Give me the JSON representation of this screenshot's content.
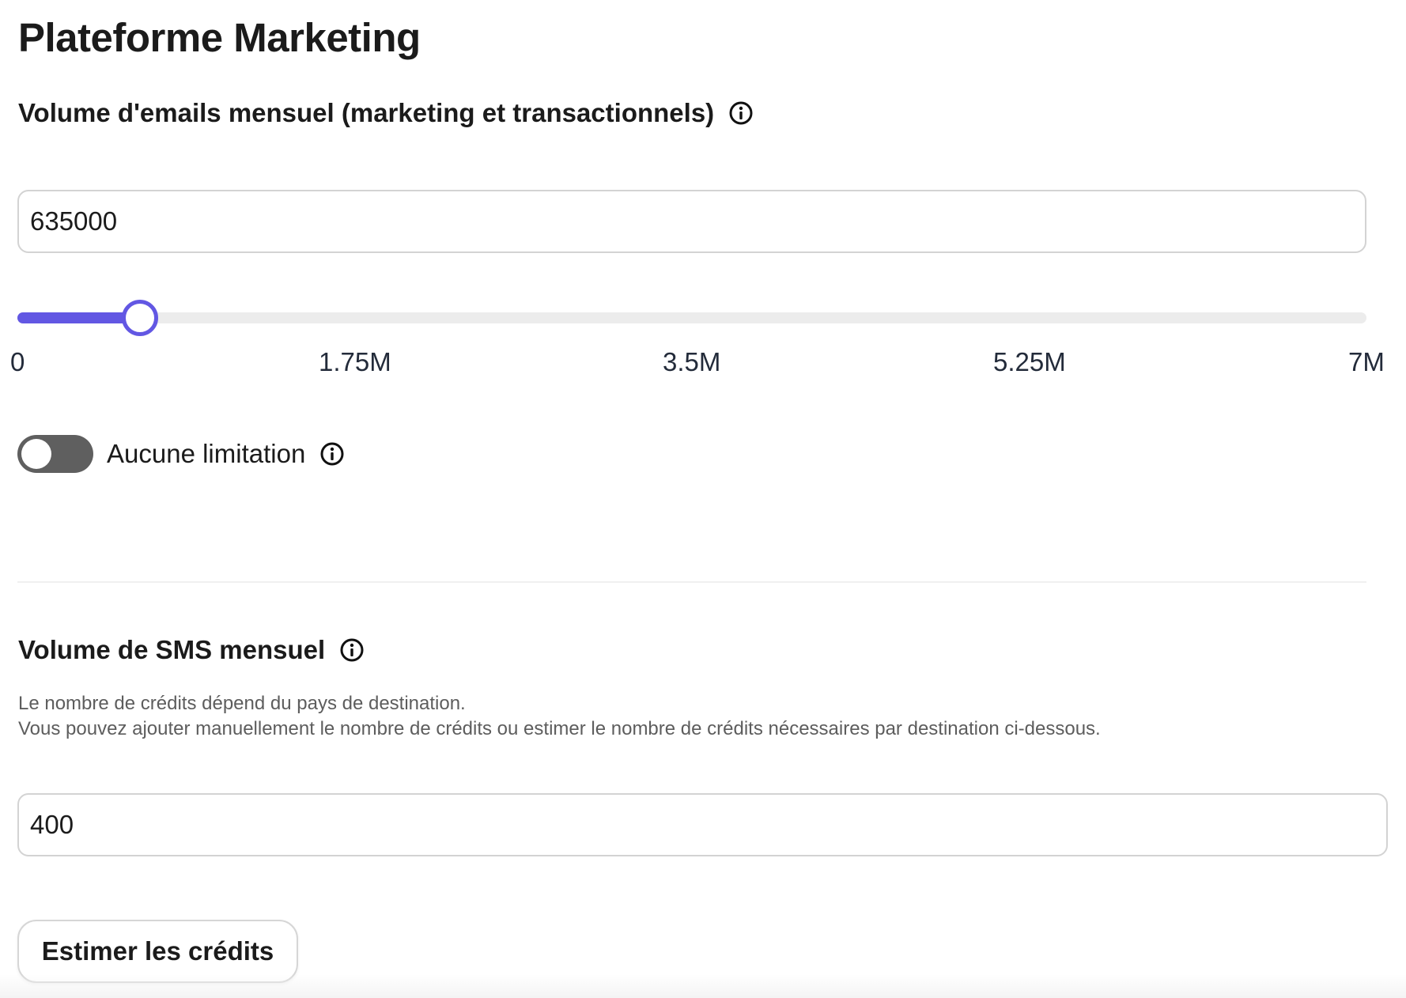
{
  "page": {
    "title": "Plateforme Marketing"
  },
  "email_section": {
    "heading": "Volume d'emails mensuel (marketing et transactionnels)",
    "info_icon": "info-circle-icon",
    "input_value": "635000",
    "slider": {
      "min": 0,
      "max": 7000000,
      "value": 635000,
      "tick_labels": [
        "0",
        "1.75M",
        "3.5M",
        "5.25M",
        "7M"
      ]
    },
    "toggle": {
      "label": "Aucune limitation",
      "checked": false
    }
  },
  "sms_section": {
    "heading": "Volume de SMS mensuel",
    "info_icon": "info-circle-icon",
    "help_line_1": "Le nombre de crédits dépend du pays de destination.",
    "help_line_2": "Vous pouvez ajouter manuellement le nombre de crédits ou estimer le nombre de crédits nécessaires par destination ci-dessous.",
    "input_value": "400",
    "estimate_button_label": "Estimer les crédits"
  },
  "colors": {
    "accent": "#6257e3",
    "toggle_off": "#5f5f5f",
    "track": "#ececec",
    "border": "#d3d3d3"
  }
}
